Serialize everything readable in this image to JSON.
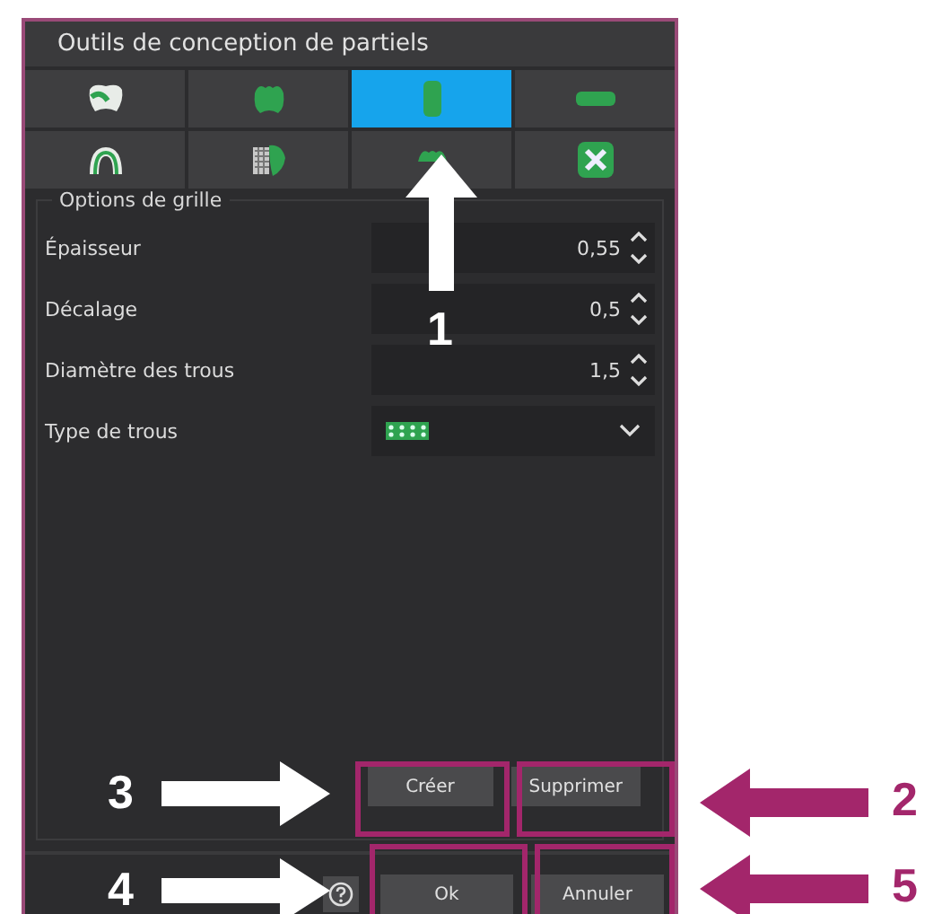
{
  "window": {
    "title": "Outils de conception de partiels"
  },
  "tools": [
    {
      "selected": false
    },
    {
      "selected": false
    },
    {
      "selected": true
    },
    {
      "selected": false
    },
    {
      "selected": false
    },
    {
      "selected": false
    },
    {
      "selected": false
    },
    {
      "selected": false
    }
  ],
  "group": {
    "title": "Options de grille"
  },
  "fields": [
    {
      "kind": "spin",
      "label": "Épaisseur",
      "value": "0,55"
    },
    {
      "kind": "spin",
      "label": "Décalage",
      "value": "0,5"
    },
    {
      "kind": "spin",
      "label": "Diamètre des trous",
      "value": "1,5"
    },
    {
      "kind": "dropdown",
      "label": "Type de trous"
    }
  ],
  "action_buttons": [
    "Créer",
    "Supprimer"
  ],
  "dialog_buttons": [
    "Ok",
    "Annuler"
  ],
  "annotations": [
    {
      "number": "1",
      "kind": "white-up"
    },
    {
      "number": "2",
      "kind": "magenta-left"
    },
    {
      "number": "3",
      "kind": "white-right"
    },
    {
      "number": "4",
      "kind": "white-right"
    },
    {
      "number": "5",
      "kind": "magenta-left"
    }
  ]
}
